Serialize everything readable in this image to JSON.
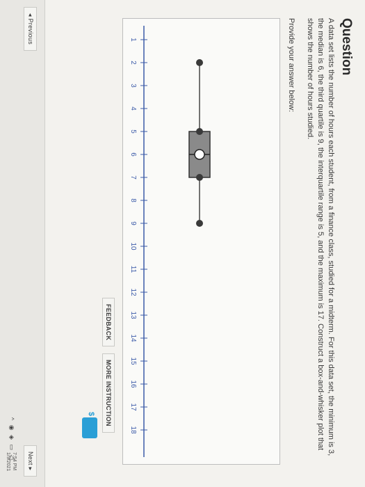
{
  "question": {
    "title": "Question",
    "text": "A data set lists the number of hours each student, from a finance class, studied for a midterm. For this data set, the minimum is 3, the median is 6, the third quartile is 9, the interquartile range is 5, and the maximum is 17. Construct a box-and-whisker plot that shows the number of hours studied.",
    "prompt": "Provide your answer below:"
  },
  "axis": {
    "ticks": [
      "1",
      "2",
      "3",
      "4",
      "5",
      "6",
      "7",
      "8",
      "9",
      "10",
      "11",
      "12",
      "13",
      "14",
      "15",
      "16",
      "17",
      "18"
    ]
  },
  "boxplot": {
    "min": 2,
    "q1": 5,
    "median": 6,
    "q3": 7,
    "max": 9
  },
  "buttons": {
    "feedback": "FEEDBACK",
    "more": "MORE INSTRUCTION",
    "previous": "Previous",
    "next": "Next"
  },
  "badge": {
    "symbol": "$"
  },
  "tray": {
    "time": "7:54 PM",
    "date": "1/9/2021"
  },
  "colors": {
    "accent": "#2a9fd6",
    "axis": "#3b5aa8",
    "box": "#555555"
  }
}
